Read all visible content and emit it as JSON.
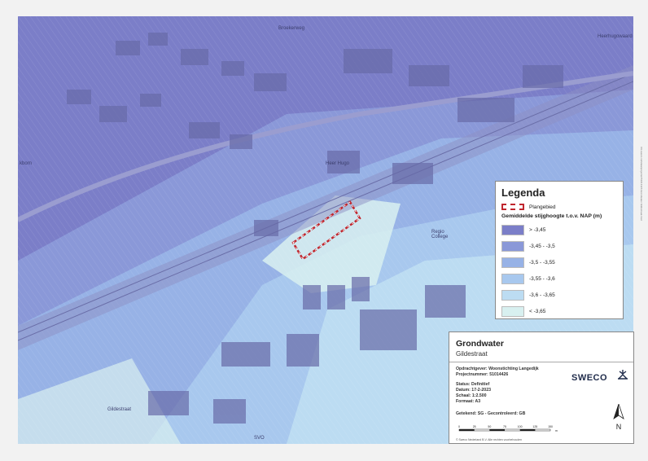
{
  "map": {
    "street_labels": [
      "Broekerweg",
      "Heer Hugo",
      "Regio College",
      "Heerhugowaard",
      "kborn",
      "Gildestraat",
      "SVO"
    ]
  },
  "legend": {
    "title": "Legenda",
    "plangebied_label": "Plangebied",
    "subtitle": "Gemiddelde stijghoogte t.o.v. NAP (m)",
    "classes": [
      {
        "label": "> -3,45",
        "color": "#7b7ec8"
      },
      {
        "label": "-3,45 - -3,5",
        "color": "#8a98d8"
      },
      {
        "label": "-3,5 - -3,55",
        "color": "#97b2e6"
      },
      {
        "label": "-3,55 - -3,6",
        "color": "#a8c8ee"
      },
      {
        "label": "-3,6 - -3,65",
        "color": "#bcdcf2"
      },
      {
        "label": "< -3,65",
        "color": "#d8f0f0"
      }
    ]
  },
  "title_block": {
    "title": "Grondwater",
    "subtitle": "Gildestraat",
    "client": "Opdrachtgever: Woonstichting Langedijk",
    "project": "Projectnummer: 51014426",
    "status": "Status: Definitief",
    "date": "Datum: 17-2-2023",
    "scale": "Schaal: 1:2.500",
    "format": "Formaat: A3",
    "drawn": "Getekend: SG - Gecontroleerd: GB",
    "logo": "SWECO",
    "north": "N",
    "scale_ticks": [
      "0",
      "25",
      "50",
      "75",
      "100",
      "125",
      "150"
    ],
    "scale_unit": "m",
    "copyright": "© Sweco Nederland B.V. Alle rechten voorbehouden"
  },
  "side_note": "\\\\nl.sweco.net\\data\\projecten\\51014426 Grondwater Gildestraat.mxd"
}
